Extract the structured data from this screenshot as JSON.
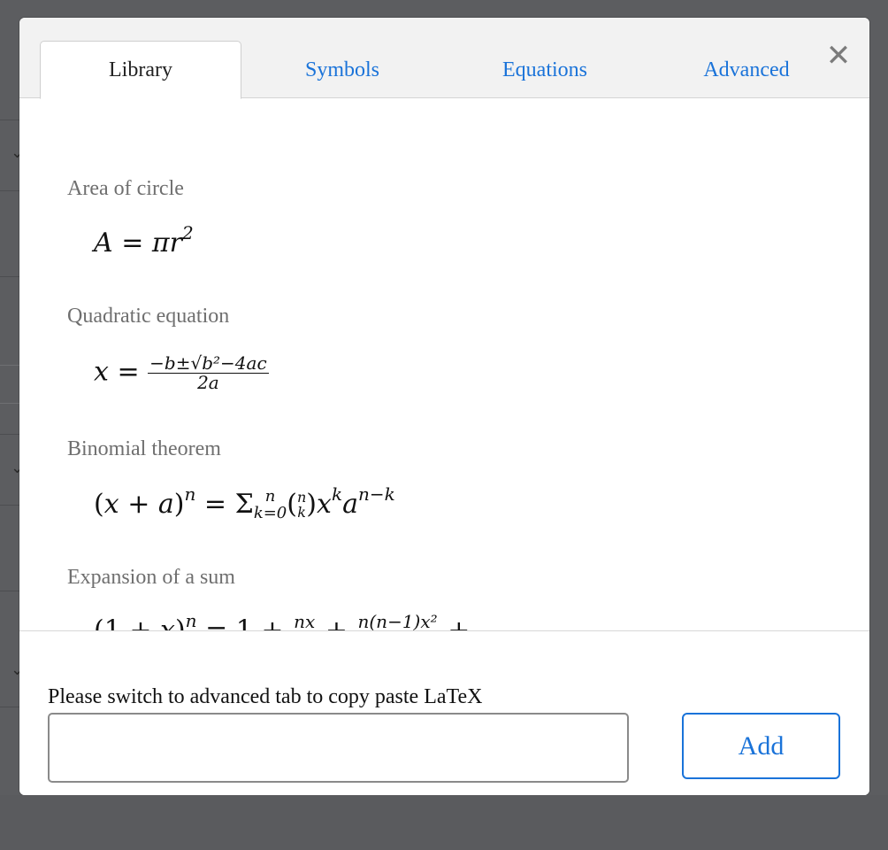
{
  "tabs": [
    {
      "label": "Library",
      "active": true
    },
    {
      "label": "Symbols",
      "active": false
    },
    {
      "label": "Equations",
      "active": false
    },
    {
      "label": "Advanced",
      "active": false
    }
  ],
  "close_icon": "close-icon",
  "library": {
    "entries": [
      {
        "title": "Area of circle"
      },
      {
        "title": "Quadratic equation"
      },
      {
        "title": "Binomial theorem"
      },
      {
        "title": "Expansion of a sum"
      }
    ]
  },
  "footer": {
    "hint": "Please switch to advanced tab to copy paste LaTeX",
    "input_value": "",
    "add_label": "Add"
  },
  "colors": {
    "accent": "#1a73d9",
    "overlay": "#5f6063"
  }
}
